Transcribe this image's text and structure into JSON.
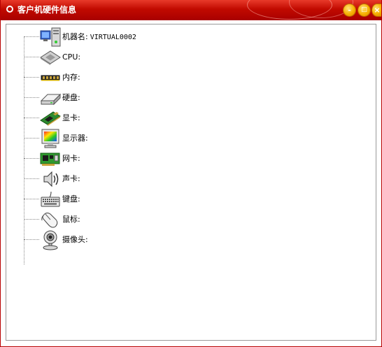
{
  "window": {
    "title": "客户机硬件信息",
    "buttons": {
      "minimize": "-",
      "maximize": "□",
      "close": "×"
    }
  },
  "tree": {
    "items": [
      {
        "label": "机器名:",
        "value": "VIRTUAL0002",
        "icon": "computer-icon"
      },
      {
        "label": "CPU:",
        "value": "",
        "icon": "cpu-icon"
      },
      {
        "label": "内存:",
        "value": "",
        "icon": "memory-icon"
      },
      {
        "label": "硬盘:",
        "value": "",
        "icon": "hard-disk-icon"
      },
      {
        "label": "显卡:",
        "value": "",
        "icon": "video-card-icon"
      },
      {
        "label": "显示器:",
        "value": "",
        "icon": "monitor-icon"
      },
      {
        "label": "网卡:",
        "value": "",
        "icon": "network-card-icon"
      },
      {
        "label": "声卡:",
        "value": "",
        "icon": "speaker-icon"
      },
      {
        "label": "键盘:",
        "value": "",
        "icon": "keyboard-icon"
      },
      {
        "label": "鼠标:",
        "value": "",
        "icon": "mouse-icon"
      },
      {
        "label": "摄像头:",
        "value": "",
        "icon": "webcam-icon"
      }
    ]
  }
}
